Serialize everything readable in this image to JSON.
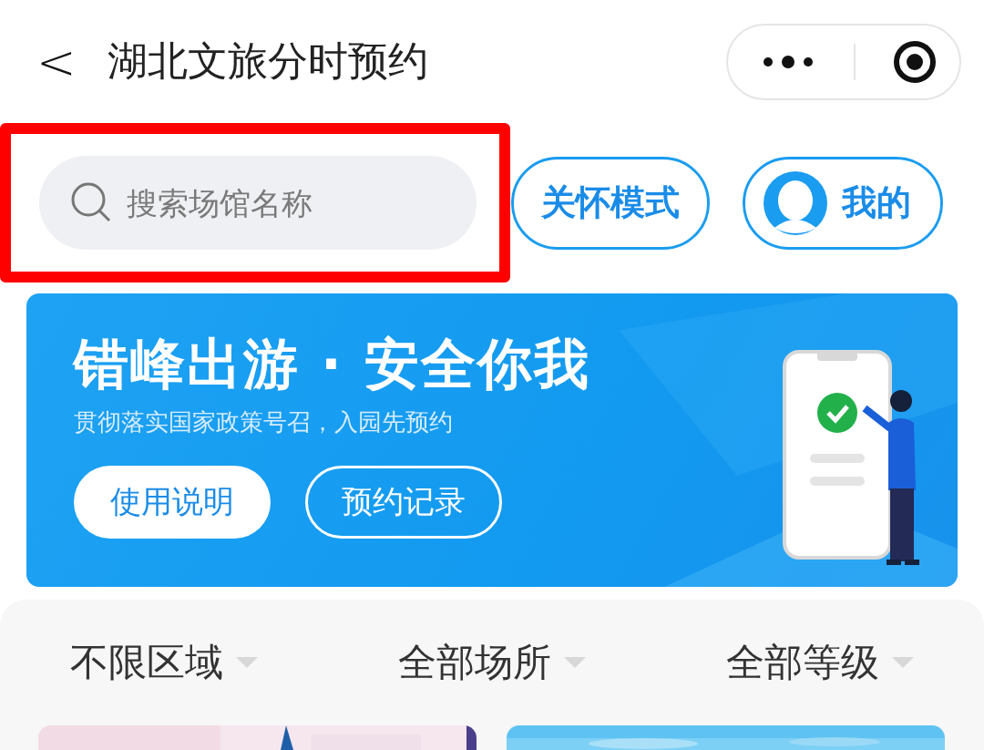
{
  "nav": {
    "back": "<",
    "title": "湖北文旅分时预约"
  },
  "search": {
    "placeholder": "搜索场馆名称",
    "highlighted": true
  },
  "header_buttons": [
    {
      "kind": "text",
      "label": "关怀模式"
    },
    {
      "kind": "avatar",
      "label": "我的"
    }
  ],
  "banner": {
    "headline": "错峰出游 · 安全你我",
    "subtitle": "贯彻落实国家政策号召，入园先预约",
    "buttons": [
      {
        "label": "使用说明",
        "kind": "filled"
      },
      {
        "label": "预约记录",
        "kind": "outline"
      }
    ]
  },
  "filters": [
    {
      "label": "不限区域"
    },
    {
      "label": "全部场所"
    },
    {
      "label": "全部等级"
    }
  ]
}
